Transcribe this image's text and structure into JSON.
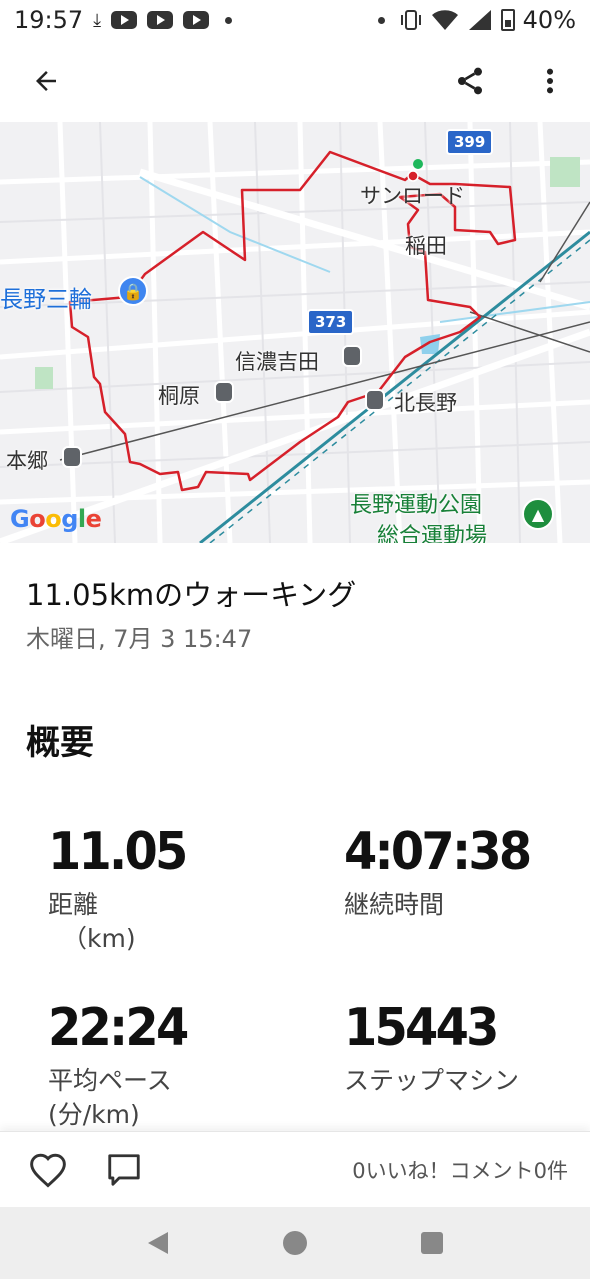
{
  "status_bar": {
    "time": "19:57",
    "battery_percent": "40%"
  },
  "map": {
    "labels": {
      "sunroad": "サンロード",
      "inada": "稲田",
      "nagano_sanwa": "長野三輪",
      "shinano_yoshida": "信濃吉田",
      "kirihara": "桐原",
      "kita_nagano": "北長野",
      "hongo": "本郷",
      "park_line1": "長野運動公園",
      "park_line2": "総合運動場"
    },
    "route_badges": {
      "r399": "399",
      "r373": "373"
    },
    "google": [
      "G",
      "o",
      "o",
      "g",
      "l",
      "e"
    ],
    "route_color": "#d6202a"
  },
  "activity": {
    "title": "11.05kmのウォーキング",
    "date": "木曜日, 7月 3 15:47"
  },
  "overview": {
    "title": "概要",
    "distance": {
      "value": "11.05",
      "label": "距離",
      "unit": "（km)"
    },
    "duration": {
      "value": "4:07:38",
      "label": "継続時間"
    },
    "pace": {
      "value": "22:24",
      "label": "平均ペース",
      "unit": "(分/km)"
    },
    "steps": {
      "value": "15443",
      "label": "ステップマシン"
    }
  },
  "actions": {
    "summary": "0いいね！コメント0件"
  }
}
